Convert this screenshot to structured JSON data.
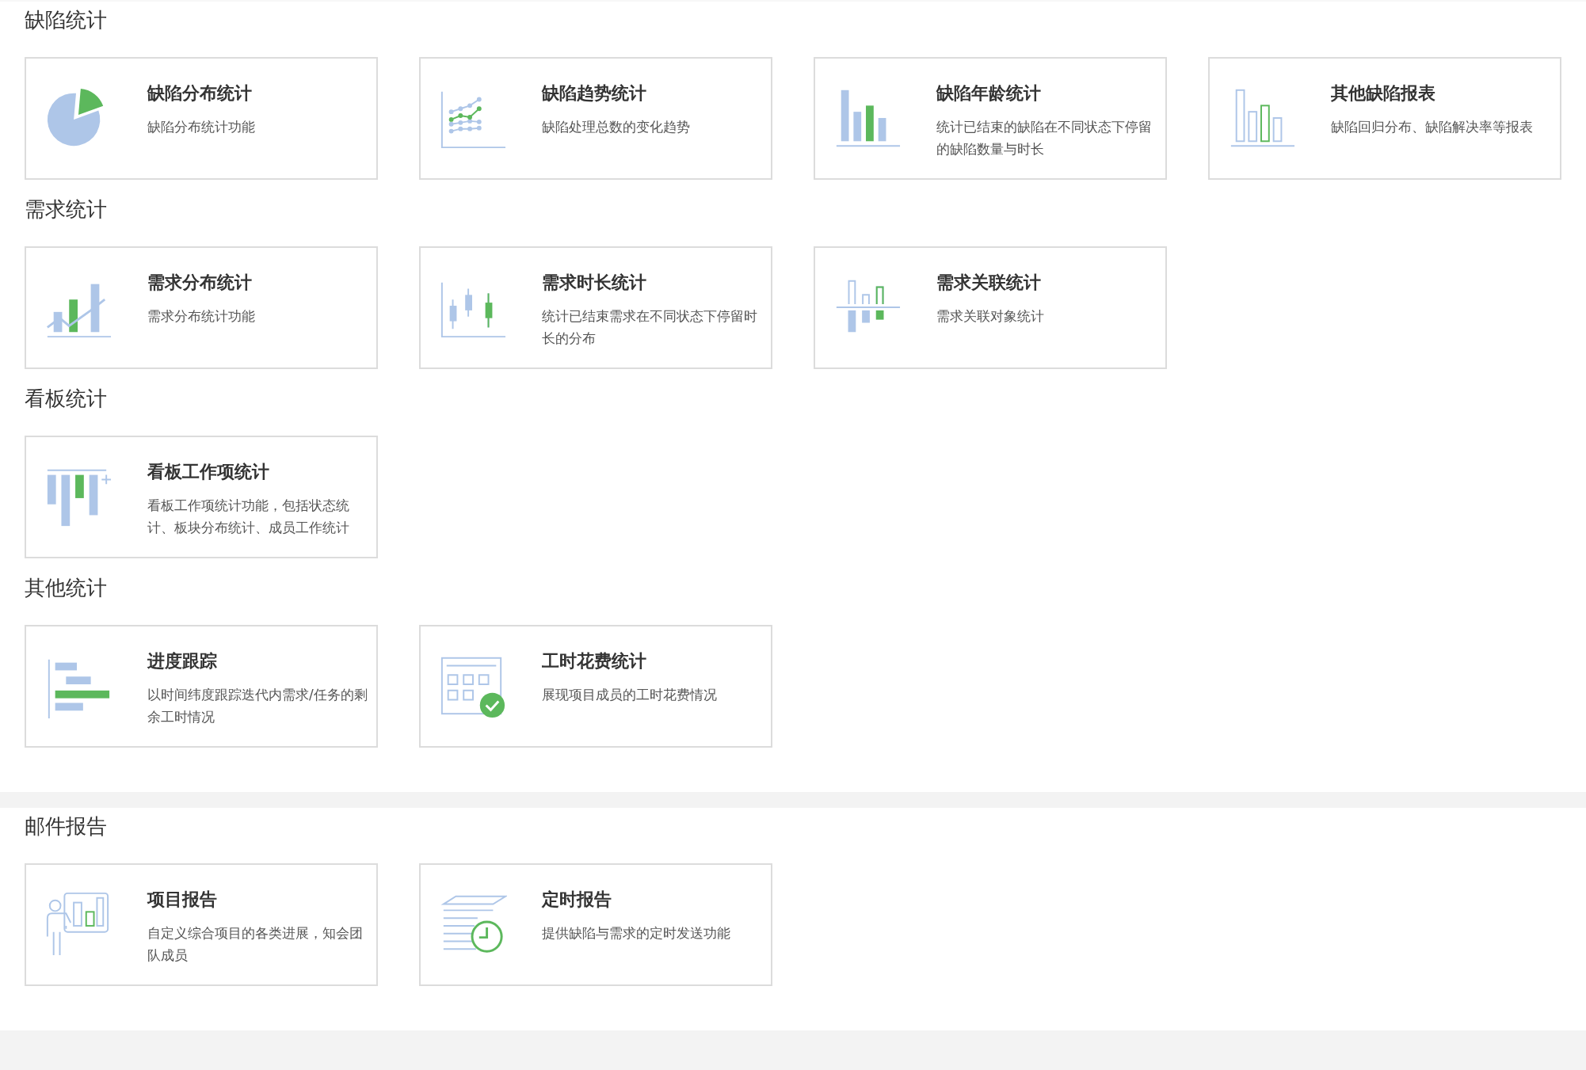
{
  "panels": [
    {
      "sections": [
        {
          "title": "缺陷统计",
          "cards": [
            {
              "kind": "pie",
              "title": "缺陷分布统计",
              "description": "缺陷分布统计功能"
            },
            {
              "kind": "trend",
              "title": "缺陷趋势统计",
              "description": "缺陷处理总数的变化趋势"
            },
            {
              "kind": "bars",
              "title": "缺陷年龄统计",
              "description": "统计已结束的缺陷在不同状态下停留的缺陷数量与时长"
            },
            {
              "kind": "bars-outline",
              "title": "其他缺陷报表",
              "description": "缺陷回归分布、缺陷解决率等报表"
            }
          ]
        },
        {
          "title": "需求统计",
          "cards": [
            {
              "kind": "bar-line",
              "title": "需求分布统计",
              "description": "需求分布统计功能"
            },
            {
              "kind": "candles",
              "title": "需求时长统计",
              "description": "统计已结束需求在不同状态下停留时长的分布"
            },
            {
              "kind": "linked",
              "title": "需求关联统计",
              "description": "需求关联对象统计"
            }
          ]
        },
        {
          "title": "看板统计",
          "cards": [
            {
              "kind": "kanban",
              "title": "看板工作项统计",
              "description": "看板工作项统计功能，包括状态统计、板块分布统计、成员工作统计"
            }
          ]
        },
        {
          "title": "其他统计",
          "cards": [
            {
              "kind": "gantt",
              "title": "进度跟踪",
              "description": "以时间纬度跟踪迭代内需求/任务的剩余工时情况"
            },
            {
              "kind": "calendar",
              "title": "工时花费统计",
              "description": "展现项目成员的工时花费情况"
            }
          ]
        }
      ]
    },
    {
      "sections": [
        {
          "title": "邮件报告",
          "cards": [
            {
              "kind": "presenter",
              "title": "项目报告",
              "description": "自定义综合项目的各类进展，知会团队成员"
            },
            {
              "kind": "schedule",
              "title": "定时报告",
              "description": "提供缺陷与需求的定时发送功能"
            }
          ]
        }
      ]
    }
  ]
}
